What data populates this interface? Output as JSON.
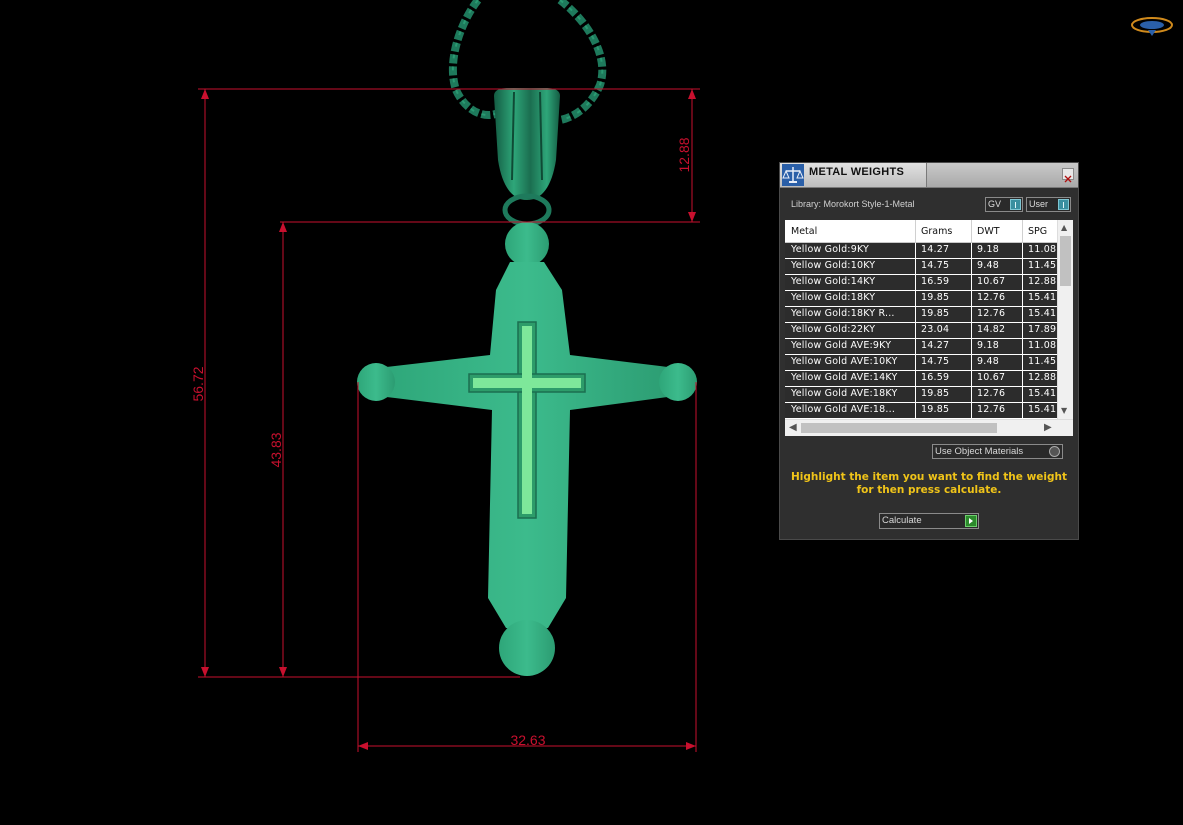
{
  "viewport": {
    "dimensions": {
      "overall_height": "56.72",
      "cross_height": "43.83",
      "bail_height": "12.88",
      "width": "32.63"
    },
    "colors": {
      "model": "#35b386",
      "model_dark": "#1f7a5a",
      "chain": "#1e7a5c",
      "dimension_lines": "#c8102e",
      "inlay": "#7ee89a"
    }
  },
  "panel": {
    "title": "METAL WEIGHTS",
    "close_icon": "close-icon",
    "library_label": "Library: Morokort Style-1-Metal",
    "toggles": {
      "gv_label": "GV",
      "user_label": "User"
    },
    "table": {
      "columns": [
        "Metal",
        "Grams",
        "DWT",
        "SPG"
      ],
      "rows": [
        [
          "Yellow Gold:9KY",
          "14.27",
          "9.18",
          "11.08"
        ],
        [
          "Yellow Gold:10KY",
          "14.75",
          "9.48",
          "11.45"
        ],
        [
          "Yellow Gold:14KY",
          "16.59",
          "10.67",
          "12.88"
        ],
        [
          "Yellow Gold:18KY",
          "19.85",
          "12.76",
          "15.41"
        ],
        [
          "Yellow Gold:18KY R...",
          "19.85",
          "12.76",
          "15.41"
        ],
        [
          "Yellow Gold:22KY",
          "23.04",
          "14.82",
          "17.89"
        ],
        [
          "Yellow Gold AVE:9KY",
          "14.27",
          "9.18",
          "11.08"
        ],
        [
          "Yellow Gold AVE:10KY",
          "14.75",
          "9.48",
          "11.45"
        ],
        [
          "Yellow Gold AVE:14KY",
          "16.59",
          "10.67",
          "12.88"
        ],
        [
          "Yellow Gold AVE:18KY",
          "19.85",
          "12.76",
          "15.41"
        ],
        [
          "Yellow Gold AVE:18...",
          "19.85",
          "12.76",
          "15.41"
        ]
      ]
    },
    "use_object_materials_label": "Use Object Materials",
    "hint": "Highlight the item you want to find the weight for then press calculate.",
    "calculate_label": "Calculate",
    "hint_color": "#f0c419"
  }
}
